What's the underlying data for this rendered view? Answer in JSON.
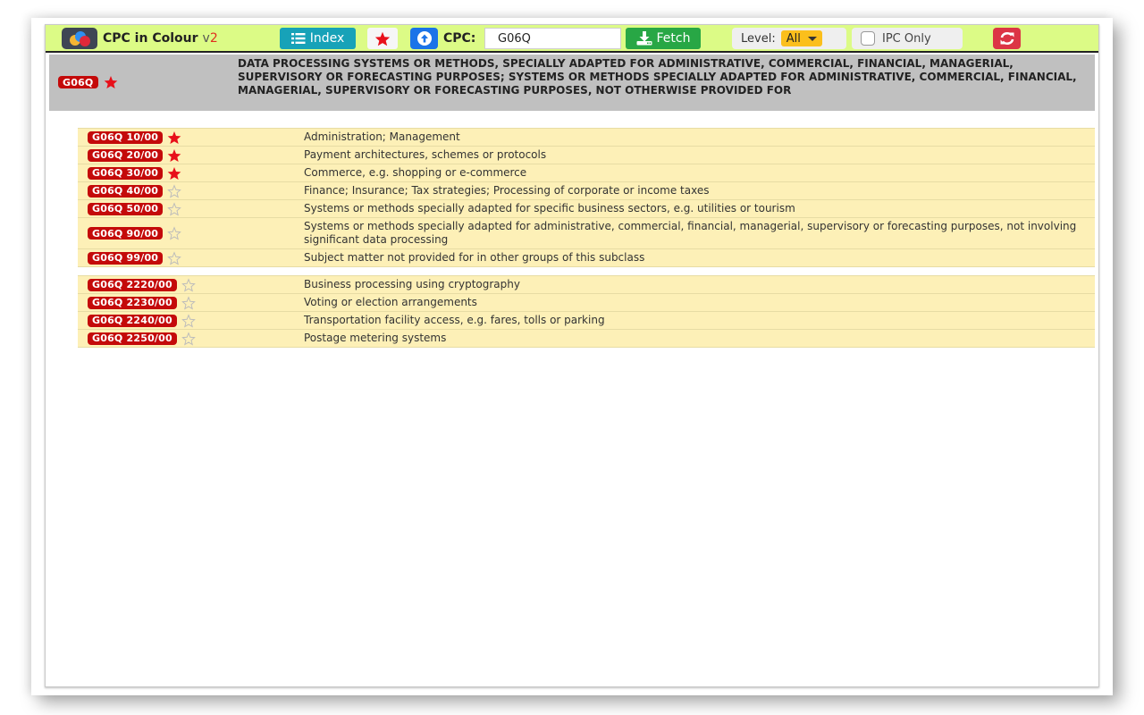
{
  "toolbar": {
    "brand": "CPC in Colour",
    "version_prefix": "v",
    "version_num": "2",
    "index_label": "Index",
    "cpc_label": "CPC:",
    "cpc_value": "G06Q",
    "fetch_label": "Fetch",
    "level_label": "Level:",
    "level_value": "All",
    "ipc_only_label": "IPC Only",
    "ipc_only_checked": false
  },
  "header": {
    "code": "G06Q",
    "favorited": true,
    "title": "DATA PROCESSING SYSTEMS OR METHODS, SPECIALLY ADAPTED FOR ADMINISTRATIVE, COMMERCIAL, FINANCIAL, MANAGERIAL, SUPERVISORY OR FORECASTING PURPOSES; SYSTEMS OR METHODS SPECIALLY ADAPTED FOR ADMINISTRATIVE, COMMERCIAL, FINANCIAL, MANAGERIAL, SUPERVISORY OR FORECASTING PURPOSES, NOT OTHERWISE PROVIDED FOR"
  },
  "groups": [
    [
      {
        "code": "G06Q 10/00",
        "favorited": true,
        "description": "Administration; Management"
      },
      {
        "code": "G06Q 20/00",
        "favorited": true,
        "description": "Payment architectures, schemes or protocols"
      },
      {
        "code": "G06Q 30/00",
        "favorited": true,
        "description": "Commerce, e.g. shopping or e-commerce"
      },
      {
        "code": "G06Q 40/00",
        "favorited": false,
        "description": "Finance; Insurance; Tax strategies; Processing of corporate or income taxes"
      },
      {
        "code": "G06Q 50/00",
        "favorited": false,
        "description": "Systems or methods specially adapted for specific business sectors, e.g. utilities or tourism"
      },
      {
        "code": "G06Q 90/00",
        "favorited": false,
        "description": "Systems or methods specially adapted for administrative, commercial, financial, managerial, supervisory or forecasting purposes, not involving significant data processing"
      },
      {
        "code": "G06Q 99/00",
        "favorited": false,
        "description": "Subject matter not provided for in other groups of this subclass"
      }
    ],
    [
      {
        "code": "G06Q 2220/00",
        "favorited": false,
        "description": "Business processing using cryptography"
      },
      {
        "code": "G06Q 2230/00",
        "favorited": false,
        "description": "Voting or election arrangements"
      },
      {
        "code": "G06Q 2240/00",
        "favorited": false,
        "description": "Transportation facility access, e.g. fares, tolls or parking"
      },
      {
        "code": "G06Q 2250/00",
        "favorited": false,
        "description": "Postage metering systems"
      }
    ]
  ],
  "colors": {
    "toolbar_bg": "#dcfb86",
    "badge_red": "#c40a0a",
    "star_filled": "#e8101a",
    "star_empty": "#bbbbbb",
    "row_bg": "#fdf0b7",
    "header_bg": "#c0c0c0"
  }
}
